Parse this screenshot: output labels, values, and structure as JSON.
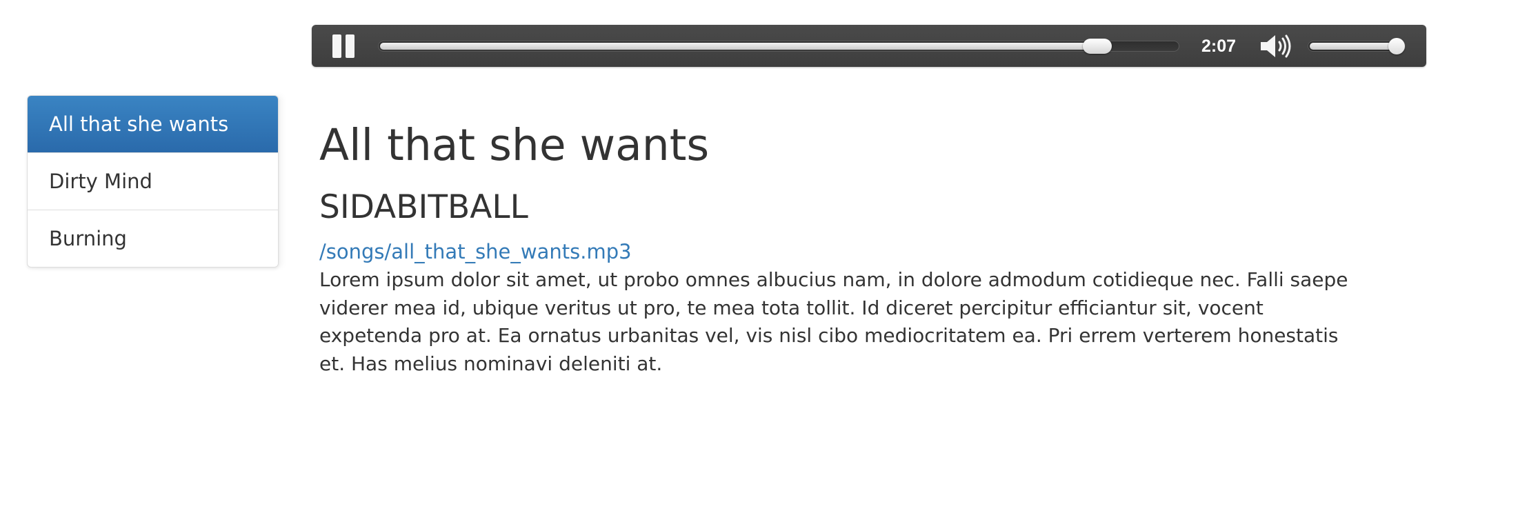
{
  "player": {
    "state": "playing",
    "progress_fraction": 0.9,
    "time": "2:07",
    "volume_fraction": 1.0,
    "icons": {
      "play_state": "pause-icon",
      "volume": "speaker-icon"
    }
  },
  "songs": [
    {
      "label": "All that she wants",
      "active": true
    },
    {
      "label": "Dirty Mind",
      "active": false
    },
    {
      "label": "Burning",
      "active": false
    }
  ],
  "main": {
    "title": "All that she wants",
    "artist": "SIDABITBALL",
    "file": "/songs/all_that_she_wants.mp3",
    "description": "Lorem ipsum dolor sit amet, ut probo omnes albucius nam, in dolore admodum cotidieque nec. Falli saepe viderer mea id, ubique veritus ut pro, te mea tota tollit. Id diceret percipitur efficiantur sit, vocent expetenda pro at. Ea ornatus urbanitas vel, vis nisl cibo mediocritatem ea. Pri errem verterem honestatis et. Has melius nominavi deleniti at."
  },
  "colors": {
    "accent": "#337ab7",
    "active_item": "#2a6aab",
    "player_bg": "#444444"
  }
}
